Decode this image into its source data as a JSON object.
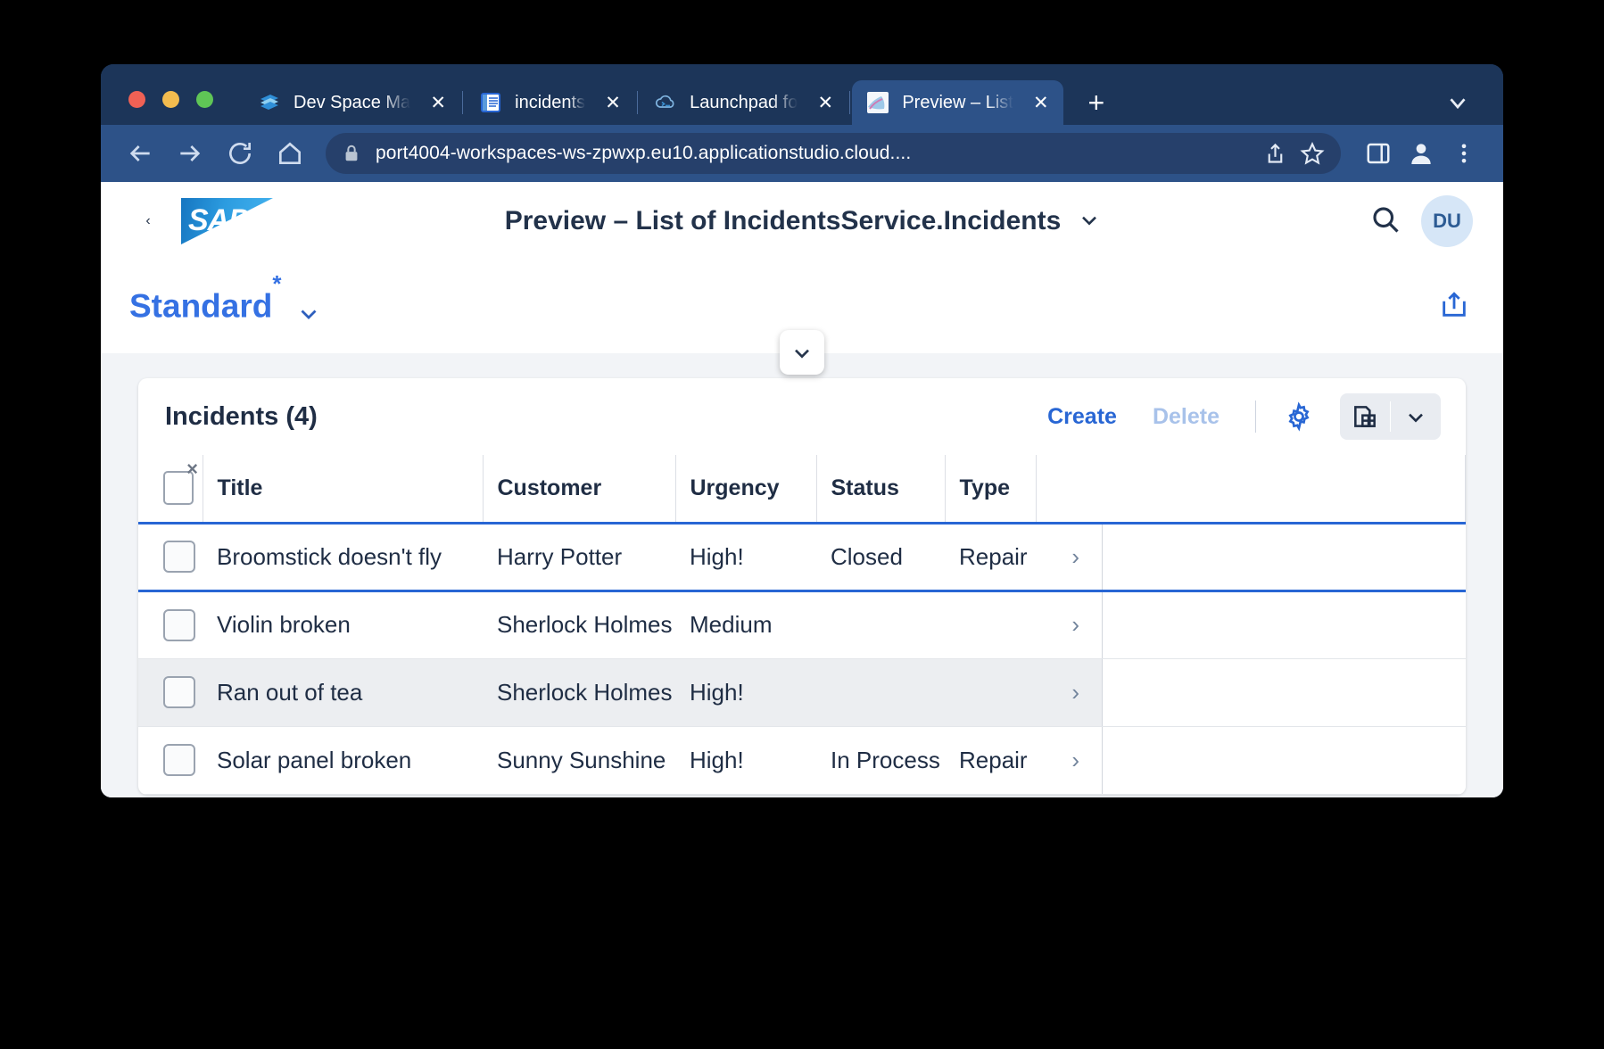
{
  "browser": {
    "tabs": [
      {
        "title": "Dev Space Ma",
        "icon": "devspace-icon",
        "active": false
      },
      {
        "title": "incidents",
        "icon": "editor-icon",
        "active": false
      },
      {
        "title": "Launchpad fo",
        "icon": "cloud-icon",
        "active": false
      },
      {
        "title": "Preview – List",
        "icon": "preview-icon",
        "active": true
      }
    ],
    "new_tab_label": "+",
    "close_label": "✕",
    "url": "port4004-workspaces-ws-zpwxp.eu10.applicationstudio.cloud....",
    "nav": {
      "back": "back-icon",
      "forward": "forward-icon",
      "reload": "reload-icon",
      "home": "home-icon"
    }
  },
  "shell": {
    "back_label": "‹",
    "logo_text": "SAP",
    "title": "Preview – List of IncidentsService.Incidents",
    "title_chevron": "⌄",
    "search_icon": "search-icon",
    "avatar_initials": "DU"
  },
  "variant": {
    "name": "Standard",
    "modified_marker": "*",
    "chevron": "⌄",
    "share_icon": "share-icon"
  },
  "table": {
    "header_title": "Incidents (4)",
    "create_label": "Create",
    "delete_label": "Delete",
    "settings_icon": "gear-icon",
    "view_icon": "table-view-icon",
    "view_chevron": "⌄",
    "columns": [
      "Title",
      "Customer",
      "Urgency",
      "Status",
      "Type"
    ],
    "rows": [
      {
        "title": "Broomstick doesn't fly",
        "customer": "Harry Potter",
        "urgency": "High!",
        "status": "Closed",
        "type": "Repair",
        "focused": true,
        "alt": false
      },
      {
        "title": "Violin broken",
        "customer": "Sherlock Holmes",
        "urgency": "Medium",
        "status": "",
        "type": "",
        "focused": false,
        "alt": false
      },
      {
        "title": "Ran out of tea",
        "customer": "Sherlock Holmes",
        "urgency": "High!",
        "status": "",
        "type": "",
        "focused": false,
        "alt": true
      },
      {
        "title": "Solar panel broken",
        "customer": "Sunny Sunshine",
        "urgency": "High!",
        "status": "In Process",
        "type": "Repair",
        "focused": false,
        "alt": false
      }
    ],
    "row_nav_chevron": "›"
  },
  "colors": {
    "accent_blue": "#2866d4",
    "urgency_orange": "#b8510e",
    "browser_chrome": "#1c3559",
    "toolbar": "#2d5288"
  }
}
